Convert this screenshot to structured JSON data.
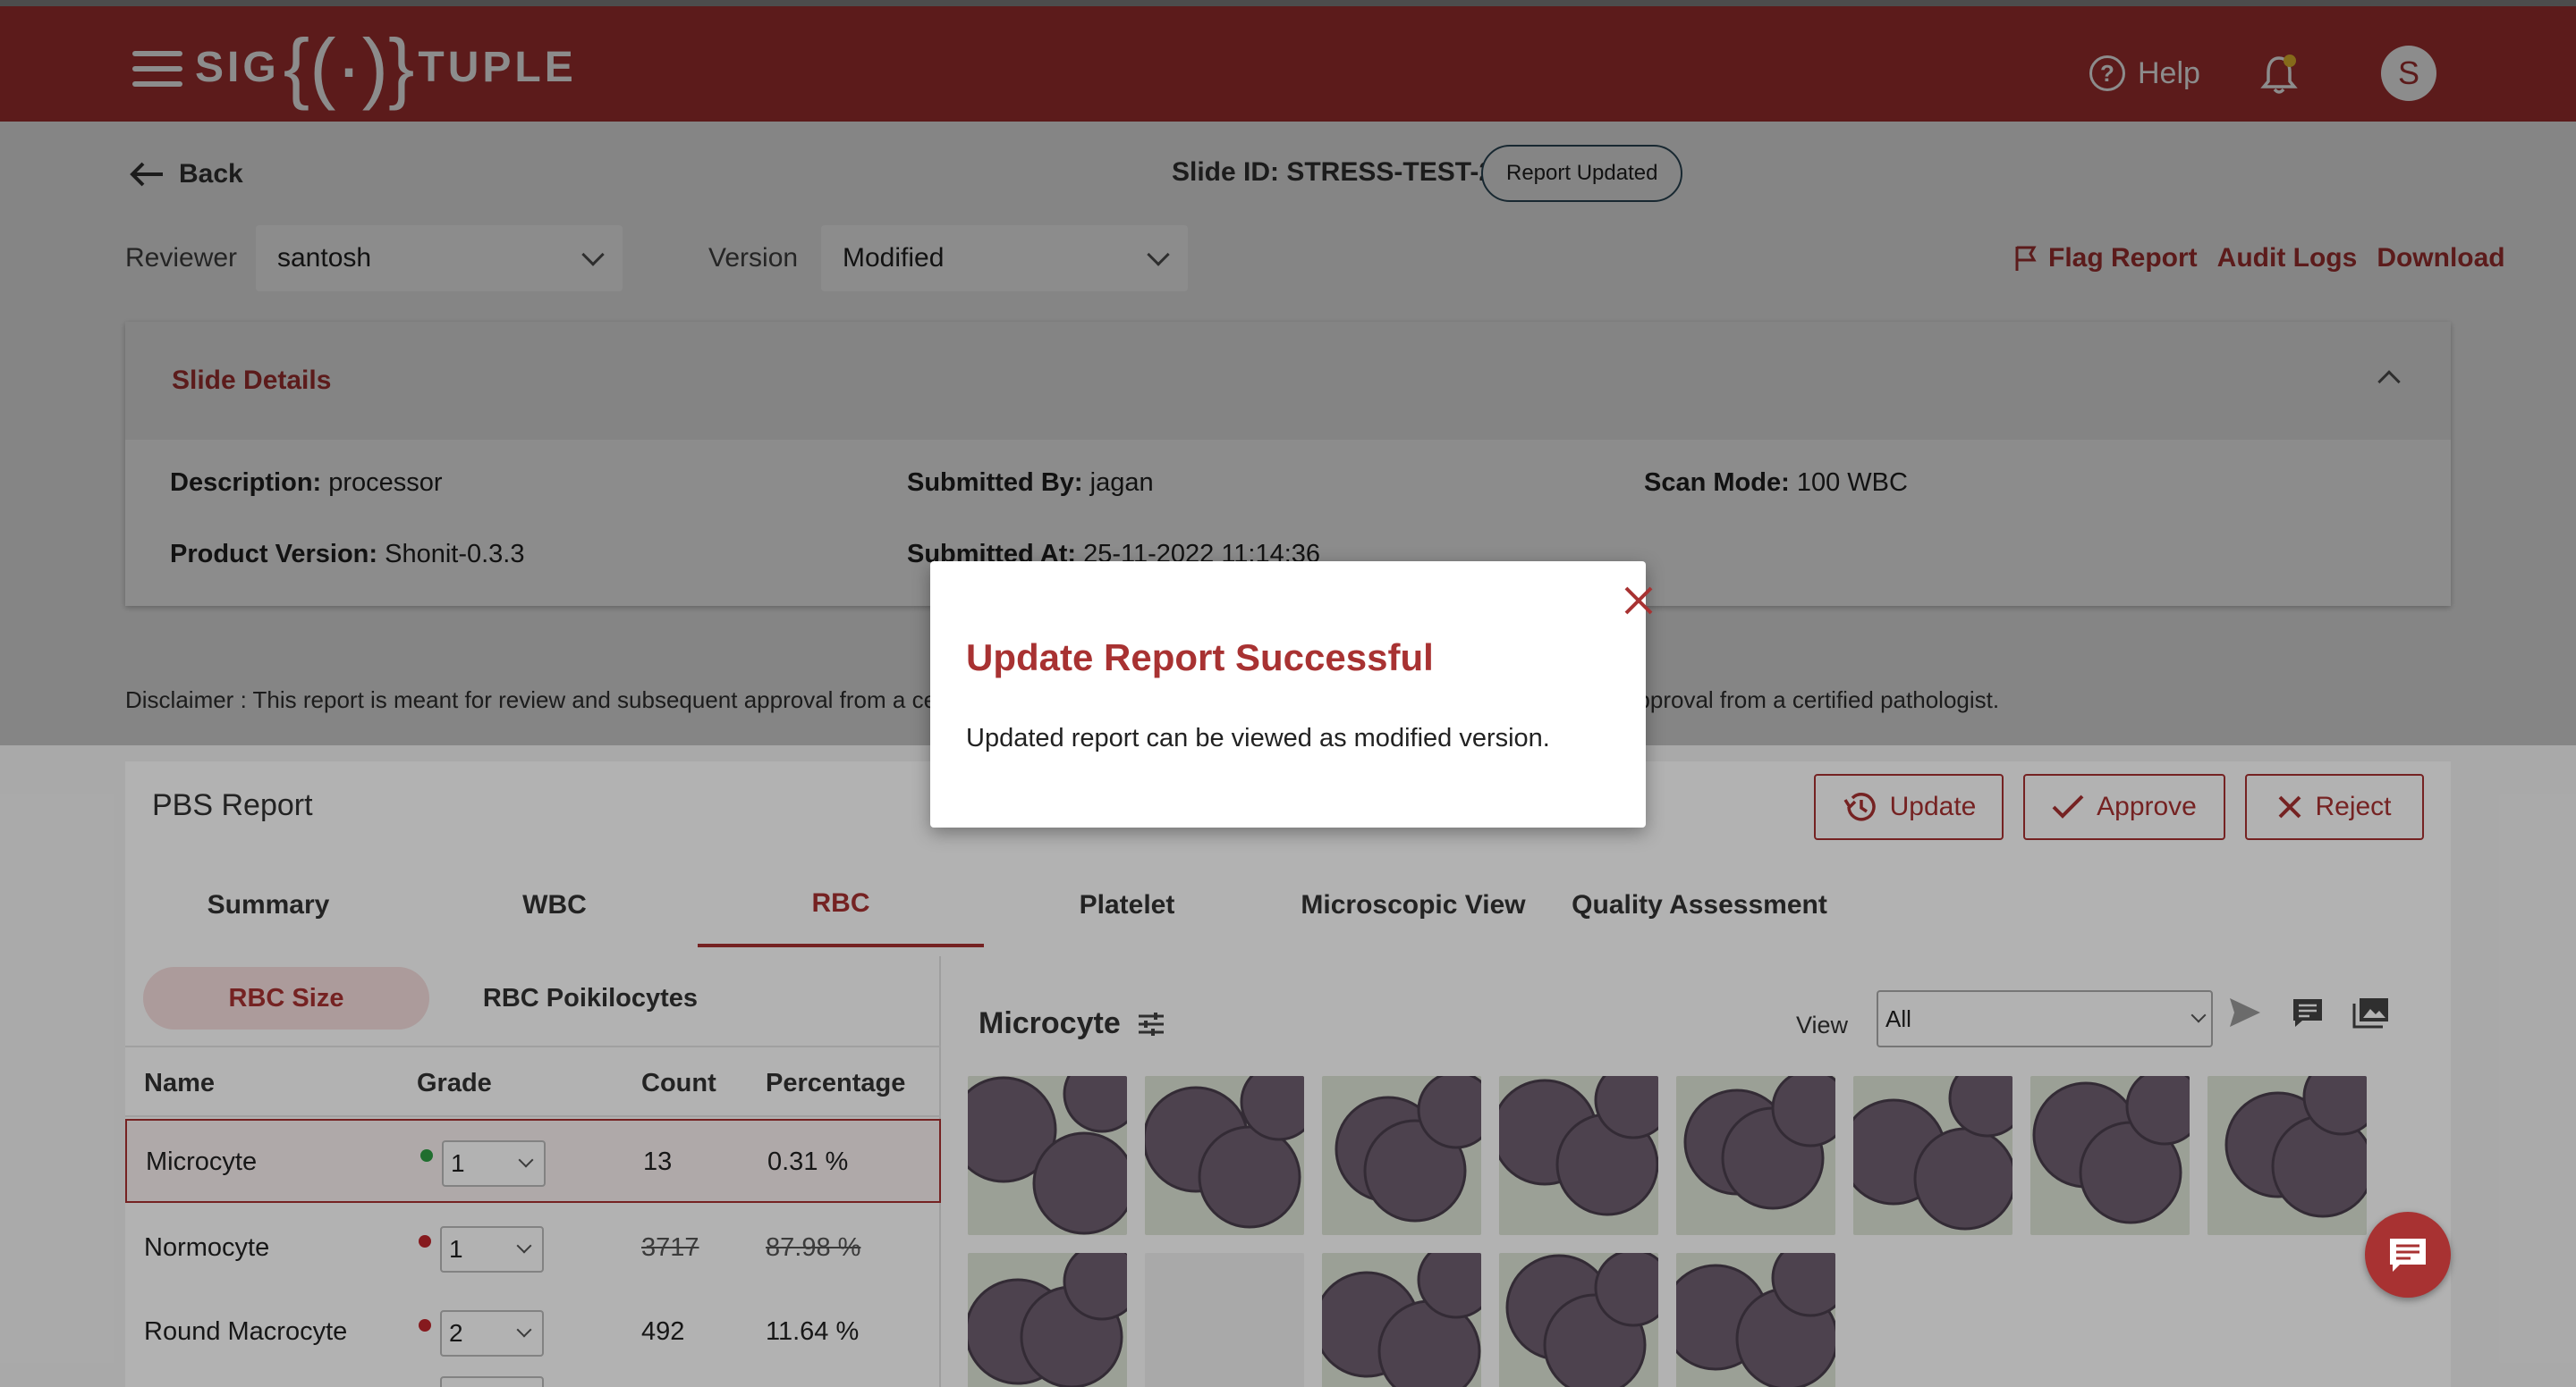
{
  "header": {
    "logo_left": "SIG",
    "logo_brace": "{(·)}",
    "logo_right": "TUPLE",
    "help_label": "Help",
    "avatar_initial": "S"
  },
  "top": {
    "back_label": "Back",
    "slide_id": "Slide ID: STRESS-TEST-25",
    "status_pill": "Report Updated",
    "reviewer_label": "Reviewer",
    "reviewer_value": "santosh",
    "version_label": "Version",
    "version_value": "Modified",
    "flag_report": "Flag Report",
    "audit_logs": "Audit Logs",
    "download": "Download"
  },
  "slide_details": {
    "title": "Slide Details",
    "description_label": "Description:",
    "description_value": "processor",
    "submitted_by_label": "Submitted By:",
    "submitted_by_value": "jagan",
    "scan_mode_label": "Scan Mode:",
    "scan_mode_value": "100 WBC",
    "product_version_label": "Product Version:",
    "product_version_value": "Shonit-0.3.3",
    "submitted_at_label": "Submitted At:",
    "submitted_at_value": "25-11-2022 11:14:36"
  },
  "disclaimer": "Disclaimer :  This report is meant for review and subsequent approval from a certified pathologist. It should not be issued to the patient without the approval from a certified pathologist.",
  "report": {
    "title": "PBS Report",
    "update_label": "Update",
    "approve_label": "Approve",
    "reject_label": "Reject",
    "tabs": [
      "Summary",
      "WBC",
      "RBC",
      "Platelet",
      "Microscopic View",
      "Quality Assessment"
    ],
    "subtabs": [
      "RBC Size",
      "RBC Poikilocytes"
    ],
    "columns": [
      "Name",
      "Grade",
      "Count",
      "Percentage"
    ],
    "rows": [
      {
        "name": "Microcyte",
        "grade": "1",
        "count": "13",
        "percentage": "0.31 %",
        "dot_color": "#2e9e44"
      },
      {
        "name": "Normocyte",
        "grade": "1",
        "count": "3717",
        "percentage": "87.98 %",
        "dot_color": "#c0262c"
      },
      {
        "name": "Round Macrocyte",
        "grade": "2",
        "count": "492",
        "percentage": "11.64 %",
        "dot_color": "#c0262c"
      }
    ],
    "gallery_title": "Microcyte",
    "view_label": "View",
    "view_value": "All"
  },
  "modal": {
    "title": "Update Report Successful",
    "body": "Updated report can be viewed as modified version."
  },
  "colors": {
    "brand": "#a83232",
    "accent_green": "#2e9e44",
    "accent_red": "#c0262c"
  }
}
